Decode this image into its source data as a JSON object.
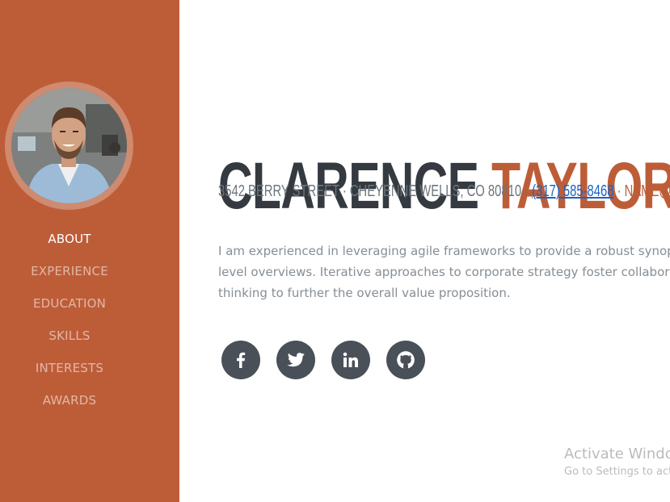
{
  "sidebar": {
    "color": "#bd5d38",
    "avatar": "profile-photo",
    "nav": [
      "ABOUT",
      "EXPERIENCE",
      "EDUCATION",
      "SKILLS",
      "INTERESTS",
      "AWARDS"
    ],
    "active_item": "ABOUT"
  },
  "header": {
    "first_name": "CLARENCE",
    "last_name": "TAYLOR",
    "address": "3542 BERRY STREET · CHEYENNE WELLS, CO 80810 · ",
    "phone": "(317) 585-8468",
    "separator": " · ",
    "email": "NAME@EMAIL.COM"
  },
  "lead": {
    "line1": "I am experienced in leveraging agile frameworks to provide a robust synopsis for high",
    "line2": "level overviews. Iterative approaches to corporate strategy foster collaborative",
    "line3": "thinking to further the overall value proposition."
  },
  "social": {
    "icons": [
      "facebook-icon",
      "twitter-icon",
      "linkedin-icon",
      "github-icon"
    ],
    "color": "#495057"
  },
  "watermark": {
    "title": "Activate Windows",
    "subtitle": "Go to Settings to activate Windows."
  }
}
